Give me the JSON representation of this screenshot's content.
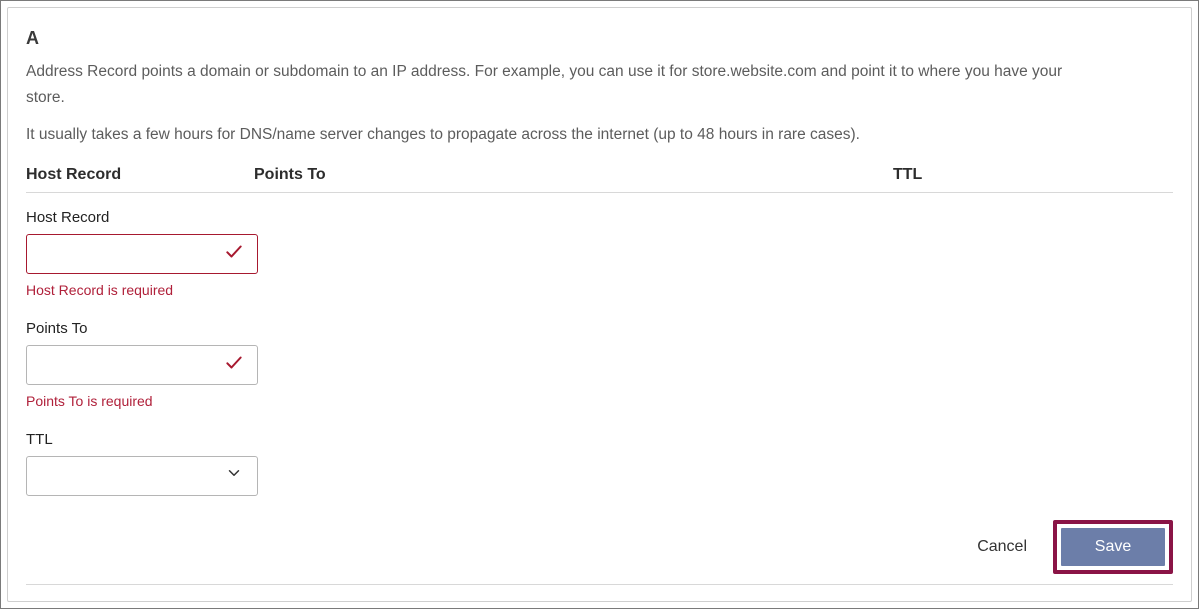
{
  "title": "A",
  "description1": "Address Record points a domain or subdomain to an IP address. For example, you can use it for store.website.com and point it to where you have your store.",
  "description2": "It usually takes a few hours for DNS/name server changes to propagate across the internet (up to 48 hours in rare cases).",
  "columns": {
    "host": "Host Record",
    "points": "Points To",
    "ttl": "TTL"
  },
  "fields": {
    "host": {
      "label": "Host Record",
      "value": "",
      "error": "Host Record is required"
    },
    "points": {
      "label": "Points To",
      "value": "",
      "error": "Points To is required"
    },
    "ttl": {
      "label": "TTL",
      "value": ""
    }
  },
  "actions": {
    "cancel": "Cancel",
    "save": "Save"
  },
  "colors": {
    "error": "#b0203a",
    "highlight_border": "#8a1446",
    "save_bg": "#6c7ea9"
  }
}
